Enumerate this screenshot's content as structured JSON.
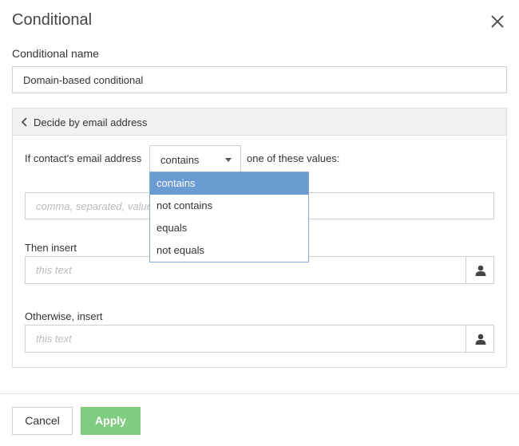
{
  "dialog": {
    "title": "Conditional",
    "close_icon": "close-icon"
  },
  "name_field": {
    "label": "Conditional name",
    "value": "Domain-based conditional"
  },
  "panel": {
    "header_label": "Decide by email address",
    "condition_prefix": "If contact's email address",
    "condition_suffix": "one of these values:",
    "operator": {
      "selected": "contains",
      "options": [
        "contains",
        "not contains",
        "equals",
        "not equals"
      ],
      "highlighted_index": 0
    },
    "values_placeholder": "comma, separated, values",
    "then_label": "Then insert",
    "then_placeholder": "this text",
    "otherwise_label": "Otherwise, insert",
    "otherwise_placeholder": "this text"
  },
  "footer": {
    "cancel_label": "Cancel",
    "apply_label": "Apply"
  },
  "colors": {
    "apply_green": "#80cc80",
    "dropdown_highlight": "#6a9cd3"
  }
}
